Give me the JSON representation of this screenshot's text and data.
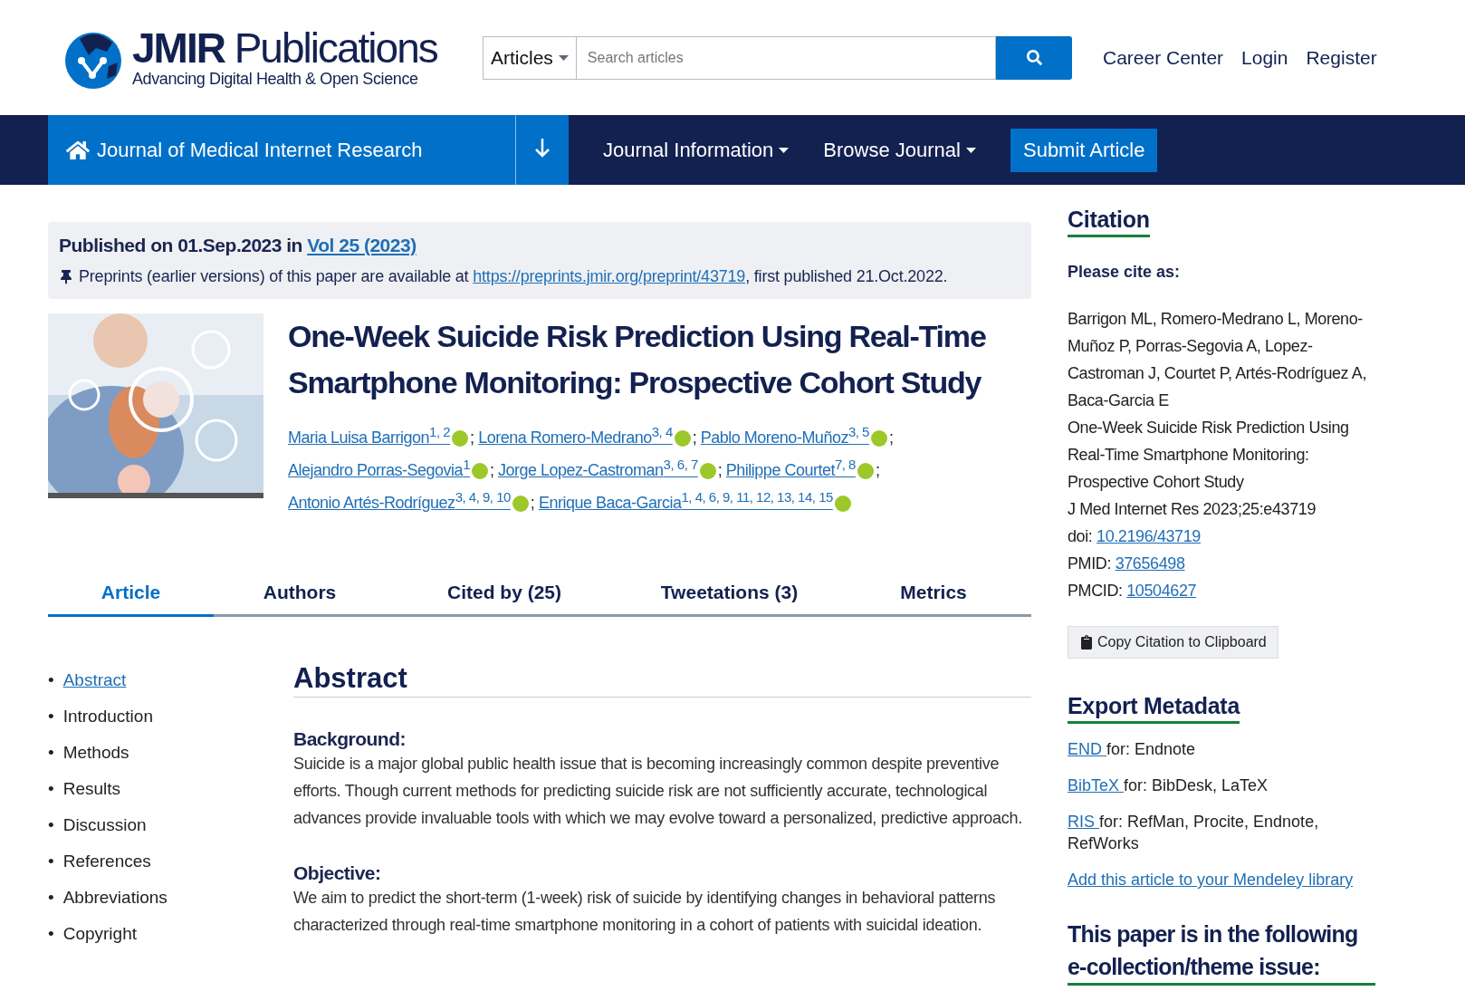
{
  "header": {
    "logo_title": "JMIR",
    "logo_title_2": "Publications",
    "logo_tagline": "Advancing Digital Health & Open Science",
    "search": {
      "scope": "Articles",
      "placeholder": "Search articles"
    },
    "links": [
      "Career Center",
      "Login",
      "Register"
    ]
  },
  "navbar": {
    "journal": "Journal of Medical Internet Research",
    "menus": [
      {
        "label": "Journal Information",
        "kind": "dropdown"
      },
      {
        "label": "Browse Journal",
        "kind": "dropdown"
      },
      {
        "label": "Submit Article",
        "kind": "button"
      }
    ]
  },
  "publication": {
    "published_prefix": "Published on 01.Sep.2023 in",
    "volume_link": "Vol 25 (2023)",
    "preprint_prefix": "Preprints (earlier versions) of this paper are available at",
    "preprint_link": "https://preprints.jmir.org/preprint/43719",
    "preprint_suffix": ", first published 21.Oct.2022."
  },
  "article": {
    "kind": "picture",
    "title": "One-Week Suicide Risk Prediction Using Real-Time Smartphone Monitoring: Prospective Cohort Study",
    "authors": [
      {
        "name": "Maria Luisa Barrigon",
        "affiliations": "1, 2",
        "separator": ";"
      },
      {
        "name": "Lorena Romero-Medrano",
        "affiliations": "3, 4",
        "separator": ";"
      },
      {
        "name": "Pablo Moreno-Muñoz",
        "affiliations": "3, 5",
        "separator": ";"
      },
      {
        "name": "Alejandro Porras-Segovia",
        "affiliations": "1",
        "separator": ";"
      },
      {
        "name": "Jorge Lopez-Castroman",
        "affiliations": "3, 6, 7",
        "separator": ";"
      },
      {
        "name": "Philippe Courtet",
        "affiliations": "7, 8",
        "separator": ";"
      },
      {
        "name": "Antonio Artés-Rodríguez",
        "affiliations": "3, 4, 9, 10",
        "separator": ";"
      },
      {
        "name": "Enrique Baca-Garcia",
        "affiliations": "1, 4, 6, 9, 11, 12, 13, 14, 15"
      }
    ]
  },
  "tabs": [
    {
      "label": "Article",
      "selected": true
    },
    {
      "label": "Authors",
      "selected": false
    },
    {
      "label": "Cited by (25)",
      "selected": false
    },
    {
      "label": "Tweetations (3)",
      "selected": false
    },
    {
      "label": "Metrics",
      "selected": false
    }
  ],
  "toc": [
    {
      "marker": "•",
      "label": "Abstract",
      "selected": true
    },
    {
      "marker": "•",
      "label": "Introduction",
      "selected": false
    },
    {
      "marker": "•",
      "label": "Methods",
      "selected": false
    },
    {
      "marker": "•",
      "label": "Results",
      "selected": false
    },
    {
      "marker": "•",
      "label": "Discussion",
      "selected": false
    },
    {
      "marker": "•",
      "label": "References",
      "selected": false
    },
    {
      "marker": "•",
      "label": "Abbreviations",
      "selected": false
    },
    {
      "marker": "•",
      "label": "Copyright",
      "selected": false
    }
  ],
  "abstract": {
    "heading": "Abstract",
    "sections": [
      {
        "heading": "Background:",
        "text": "Suicide is a major global public health issue that is becoming increasingly common despite preventive efforts. Though current methods for predicting suicide risk are not sufficiently accurate, technological advances provide invaluable tools with which we may evolve toward a personalized, predictive approach."
      },
      {
        "heading": "Objective:",
        "text": "We aim to predict the short-term (1-week) risk of suicide by identifying changes in behavioral patterns characterized through real-time smartphone monitoring in a cohort of patients with suicidal ideation."
      }
    ]
  },
  "citation": {
    "heading": "Citation",
    "cite_label": "Please cite as:",
    "authors": "Barrigon ML, Romero-Medrano L, Moreno-Muñoz P, Porras-Segovia A, Lopez-Castroman J, Courtet P, Artés-Rodríguez A, Baca-Garcia E",
    "title": "One-Week Suicide Risk Prediction Using Real-Time Smartphone Monitoring: Prospective Cohort Study",
    "journal": "J Med Internet Res 2023;25:e43719",
    "ids": [
      {
        "label": "doi:",
        "value": "10.2196/43719"
      },
      {
        "label": "PMID:",
        "value": "37656498"
      },
      {
        "label": "PMCID:",
        "value": "10504627"
      }
    ],
    "copy_button": "Copy Citation to Clipboard"
  },
  "export": {
    "heading": "Export Metadata",
    "formats": [
      {
        "link": "END ",
        "text": "for: Endnote"
      },
      {
        "link": "BibTeX ",
        "text": "for: BibDesk, LaTeX"
      },
      {
        "link": "RIS ",
        "text": "for: RefMan, Procite, Endnote, RefWorks"
      }
    ],
    "mendeley_link": "Add this article to your Mendeley library"
  },
  "collection": {
    "heading": "This paper is in the following e-collection/theme issue:"
  }
}
